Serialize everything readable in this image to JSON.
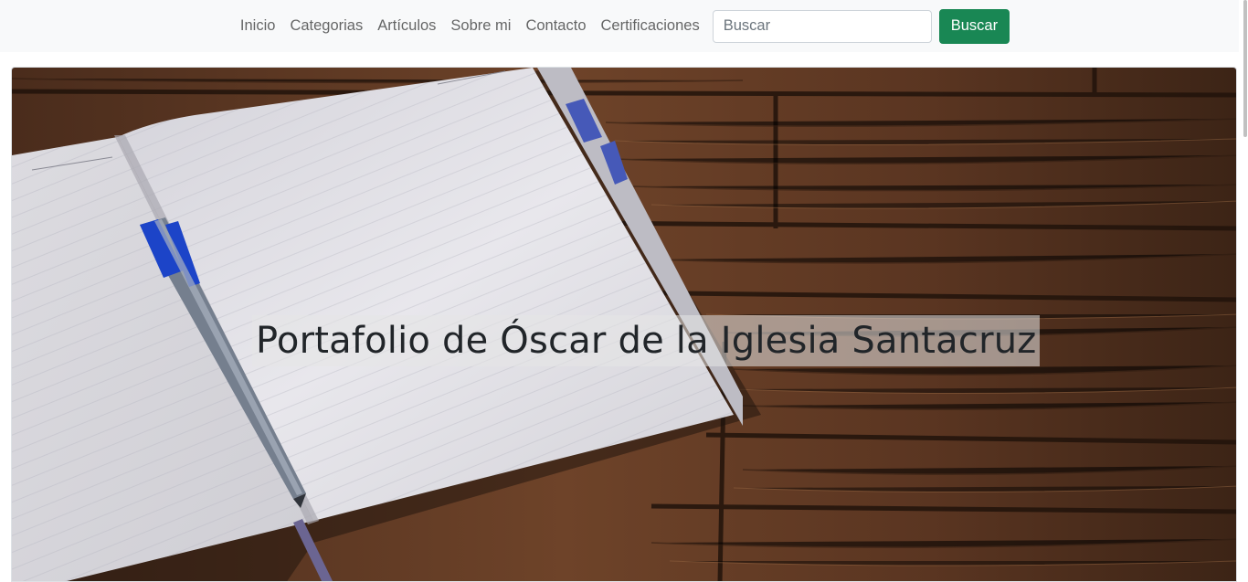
{
  "nav": {
    "items": [
      {
        "label": "Inicio"
      },
      {
        "label": "Categorias"
      },
      {
        "label": "Artículos"
      },
      {
        "label": "Sobre mi"
      },
      {
        "label": "Contacto"
      },
      {
        "label": "Certificaciones"
      }
    ],
    "search": {
      "placeholder": "Buscar",
      "value": ""
    },
    "search_button_label": "Buscar"
  },
  "hero": {
    "title": "Portafolio de Óscar de la Iglesia Santacruz",
    "image_icon": "notebook-pen-wood-photo"
  },
  "colors": {
    "navbar_bg": "#f8f9fa",
    "button_bg": "#198754",
    "wood_dark": "#3b2518",
    "wood_mid": "#6b4128",
    "paper": "#e9e8ec"
  }
}
